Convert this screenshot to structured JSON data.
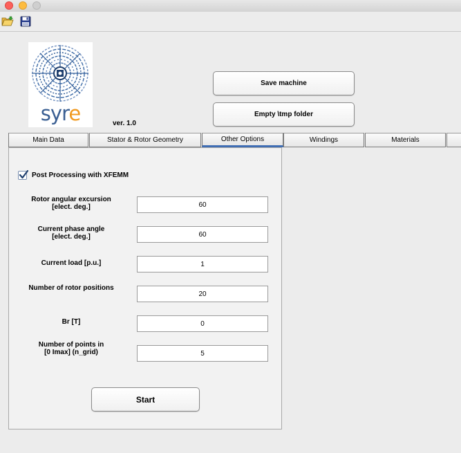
{
  "window": {
    "controls": [
      "close",
      "minimize",
      "zoom"
    ]
  },
  "toolbar": {
    "open_icon": "folder-open-icon",
    "save_icon": "floppy-save-icon"
  },
  "logo": {
    "text_main": "syr",
    "text_accent": "e",
    "colors": {
      "main": "#3a5f93",
      "accent": "#f19a1f"
    }
  },
  "version": "ver. 1.0",
  "buttons": {
    "save_machine": "Save machine",
    "empty_tmp": "Empty \\tmp folder",
    "start": "Start"
  },
  "tabs": [
    {
      "label": "Main Data"
    },
    {
      "label": "Stator & Rotor Geometry"
    },
    {
      "label": "Other Options",
      "active": true
    },
    {
      "label": "Windings"
    },
    {
      "label": "Materials"
    },
    {
      "label": ""
    }
  ],
  "post_processing": {
    "label": "Post Processing with XFEMM",
    "checked": true
  },
  "fields": [
    {
      "label": "Rotor angular excursion\n[elect. deg.]",
      "value": "60"
    },
    {
      "label": "Current phase angle\n[elect. deg.]",
      "value": "60"
    },
    {
      "label": "Current load [p.u.]",
      "value": "1"
    },
    {
      "label": "Number of rotor positions",
      "value": "20"
    },
    {
      "label": "Br [T]",
      "value": "0"
    },
    {
      "label": "Number of points  in\n[0 Imax] (n_grid)",
      "value": "5"
    }
  ],
  "colors": {
    "background": "#ececec",
    "panel": "#f2f2f2",
    "active_tab": "#3f6db3",
    "checkbox_check": "#1f3f6e"
  }
}
